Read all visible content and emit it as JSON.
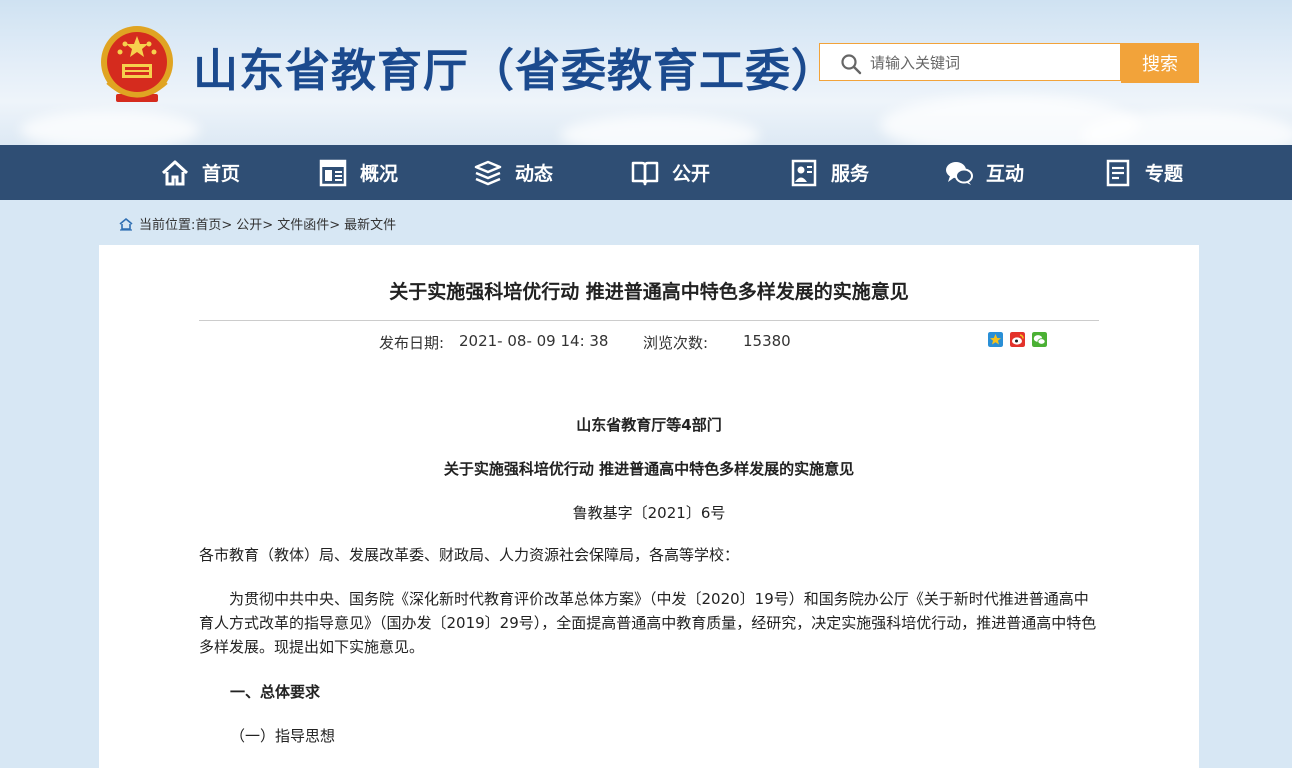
{
  "header": {
    "site_title": "山东省教育厅（省委教育工委）",
    "search_placeholder": "请输入关键词",
    "search_button": "搜索"
  },
  "nav": {
    "items": [
      {
        "label": "首页",
        "icon": "home-icon"
      },
      {
        "label": "概况",
        "icon": "overview-icon"
      },
      {
        "label": "动态",
        "icon": "news-stack-icon"
      },
      {
        "label": "公开",
        "icon": "book-icon"
      },
      {
        "label": "服务",
        "icon": "service-icon"
      },
      {
        "label": "互动",
        "icon": "chat-icon"
      },
      {
        "label": "专题",
        "icon": "document-icon"
      }
    ]
  },
  "breadcrumb": {
    "prefix": "当前位置:",
    "items": [
      "首页>",
      "公开>",
      "文件函件>",
      "最新文件"
    ]
  },
  "article": {
    "title": "关于实施强科培优行动 推进普通高中特色多样发展的实施意见",
    "publish_label": "发布日期:",
    "publish_date": "2021- 08- 09 14: 38",
    "views_label": "浏览次数:",
    "views": "15380",
    "issuer": "山东省教育厅等4部门",
    "doc_title": "关于实施强科培优行动 推进普通高中特色多样发展的实施意见",
    "doc_number": "鲁教基字〔2021〕6号",
    "recipients": "各市教育（教体）局、发展改革委、财政局、人力资源社会保障局，各高等学校：",
    "intro": "为贯彻中共中央、国务院《深化新时代教育评价改革总体方案》（中发〔2020〕19号）和国务院办公厅《关于新时代推进普通高中育人方式改革的指导意见》（国办发〔2019〕29号），全面提高普通高中教育质量，经研究，决定实施强科培优行动，推进普通高中特色多样发展。现提出如下实施意见。",
    "section1": "一、总体要求",
    "subsection1": "（一）指导思想"
  },
  "colors": {
    "nav_bg": "#2f4e74",
    "title_blue": "#1b4a8e",
    "search_accent": "#f2a33a"
  }
}
